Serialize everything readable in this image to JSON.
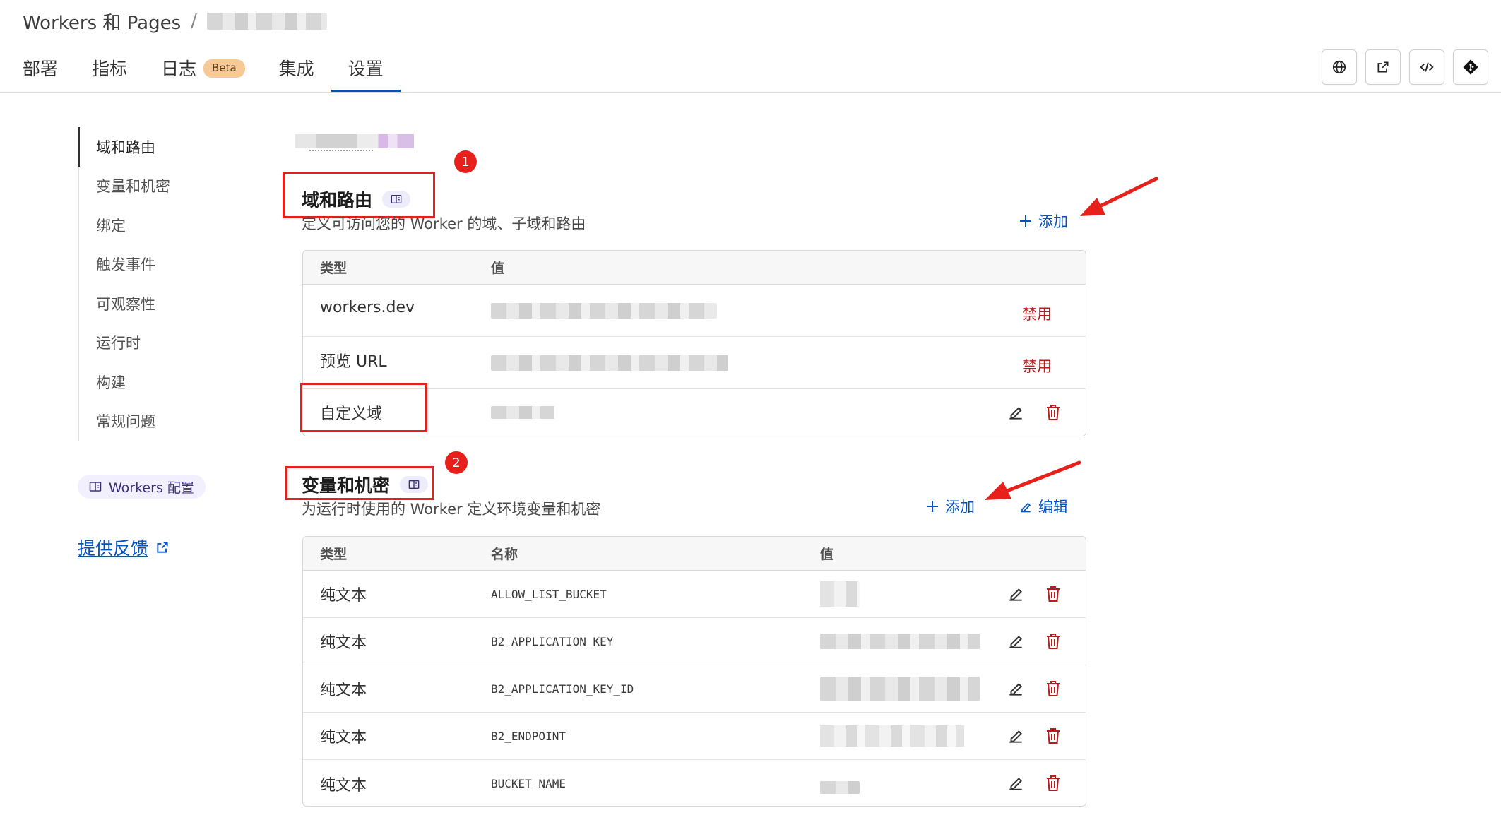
{
  "breadcrumb": {
    "root": "Workers 和 Pages",
    "separator": "/"
  },
  "tabs": [
    {
      "label": "部署"
    },
    {
      "label": "指标"
    },
    {
      "label": "日志",
      "badge": "Beta"
    },
    {
      "label": "集成"
    },
    {
      "label": "设置"
    }
  ],
  "toolbar_icons": [
    "globe-icon",
    "external-link-icon",
    "code-icon",
    "git-icon"
  ],
  "sidenav": {
    "items": [
      "域和路由",
      "变量和机密",
      "绑定",
      "触发事件",
      "可观察性",
      "运行时",
      "构建",
      "常规问题"
    ],
    "workers_config": "Workers 配置",
    "feedback": "提供反馈"
  },
  "domains": {
    "title": "域和路由",
    "description": "定义可访问您的 Worker 的域、子域和路由",
    "add_label": "添加",
    "headers": {
      "type": "类型",
      "value": "值"
    },
    "rows": [
      {
        "type": "workers.dev",
        "action": "禁用"
      },
      {
        "type": "预览 URL",
        "action": "禁用"
      },
      {
        "type": "自定义域"
      }
    ]
  },
  "variables": {
    "title": "变量和机密",
    "description": "为运行时使用的 Worker 定义环境变量和机密",
    "add_label": "添加",
    "edit_label": "编辑",
    "headers": {
      "type": "类型",
      "name": "名称",
      "value": "值"
    },
    "rows": [
      {
        "type": "纯文本",
        "name": "ALLOW_LIST_BUCKET"
      },
      {
        "type": "纯文本",
        "name": "B2_APPLICATION_KEY"
      },
      {
        "type": "纯文本",
        "name": "B2_APPLICATION_KEY_ID"
      },
      {
        "type": "纯文本",
        "name": "B2_ENDPOINT"
      },
      {
        "type": "纯文本",
        "name": "BUCKET_NAME"
      }
    ]
  },
  "annotations": {
    "marker_1": "1",
    "marker_2": "2"
  },
  "colors": {
    "accent": "#0051c3",
    "danger": "#b81d1d",
    "annotation": "#e8201b"
  }
}
